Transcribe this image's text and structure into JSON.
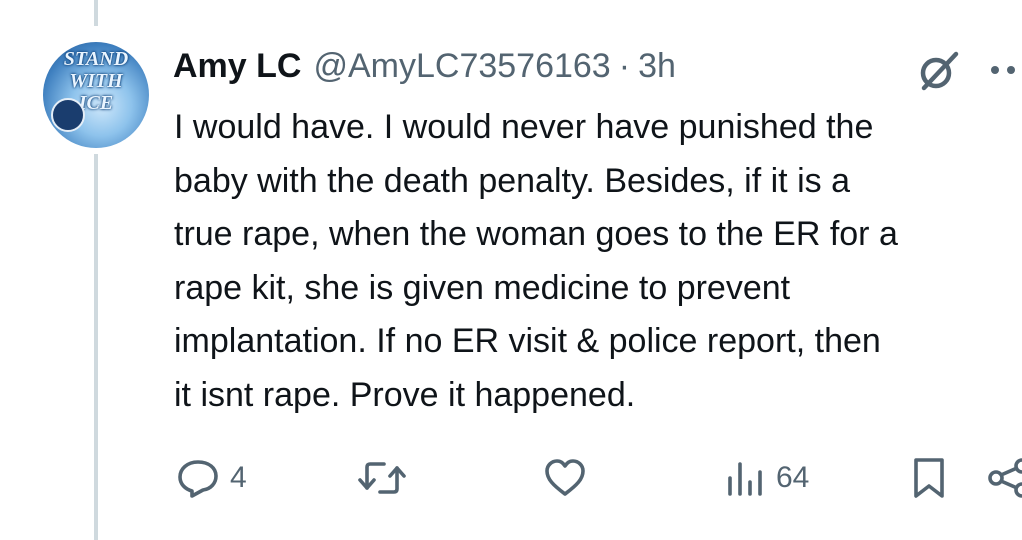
{
  "tweet": {
    "author": {
      "display_name": "Amy LC",
      "handle": "@AmyLC73576163",
      "separator": "·",
      "time": "3h",
      "avatar_text": [
        "STAND",
        "WITH",
        "ICE"
      ]
    },
    "text_lines": [
      "I would have. I would never have punished the",
      "baby with the death penalty. Besides, if it is a",
      "true rape, when the woman goes to the ER for a",
      "rape kit, she is given medicine to prevent",
      "implantation. If no ER visit & police report, then",
      "it isnt rape. Prove it happened."
    ],
    "actions": {
      "reply_count": "4",
      "repost_count": "",
      "like_count": "",
      "views_count": "64"
    },
    "icons": {
      "reply": "reply-icon",
      "repost": "repost-icon",
      "like": "like-icon",
      "views": "views-icon",
      "bookmark": "bookmark-icon",
      "share": "share-icon",
      "grok": "grok-icon",
      "more": "more-icon"
    },
    "colors": {
      "text": "#0f1419",
      "secondary": "#536471",
      "thread_line": "#cfd9de"
    }
  }
}
